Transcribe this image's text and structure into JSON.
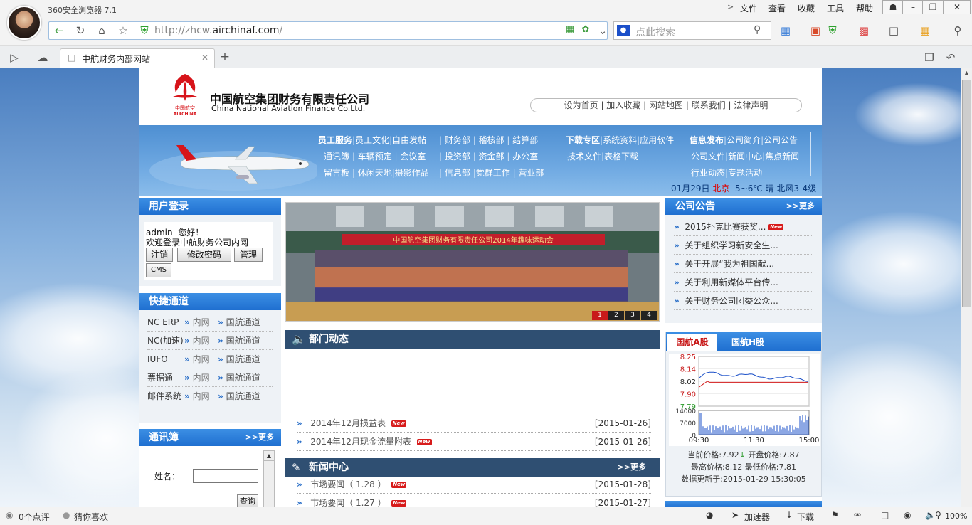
{
  "browser": {
    "name": "360安全浏览器 7.1",
    "menu": [
      "文件",
      "查看",
      "收藏",
      "工具",
      "帮助"
    ],
    "url_prefix": "http://zhcw.",
    "url_domain": "airchinaf.com",
    "url_suffix": "/",
    "search_placeholder": "点此搜索",
    "tab_title": "中航财务内部网站"
  },
  "status": {
    "comments": "0个点评",
    "guess": "猜你喜欢",
    "accelerator": "加速器",
    "download": "下载",
    "zoom": "100%"
  },
  "header": {
    "company_cn": "中国航空集团财务有限责任公司",
    "company_en": "China National Aviation Finance Co.Ltd.",
    "logo_cn": "中国航空",
    "logo_en": "AIRCHINA",
    "top_links": [
      "设为首页",
      "加入收藏",
      "网站地图",
      "联系我们",
      "法律声明"
    ]
  },
  "banner_nav": {
    "group1": {
      "title": "员工服务",
      "rows": [
        [
          "员工文化",
          "自由发帖"
        ],
        [
          "通讯簿",
          "车辆预定",
          "会议室"
        ],
        [
          "留言板",
          "休闲天地",
          "摄影作品"
        ]
      ]
    },
    "group2": {
      "rows": [
        [
          "财务部",
          "稽核部",
          "结算部"
        ],
        [
          "投资部",
          "资金部",
          "办公室"
        ],
        [
          "信息部",
          "党群工作",
          "营业部"
        ]
      ]
    },
    "group3": {
      "title": "下载专区",
      "rows": [
        [
          "系统资料",
          "应用软件"
        ],
        [
          "技术文件",
          "表格下载"
        ]
      ]
    },
    "group4": {
      "title": "信息发布",
      "rows": [
        [
          "公司简介",
          "公司公告"
        ],
        [
          "公司文件",
          "新闻中心",
          "焦点新闻"
        ],
        [
          "行业动态",
          "专题活动"
        ]
      ]
    }
  },
  "weather": {
    "date": "01月29日",
    "city": "北京",
    "temp": "5~6℃",
    "cond": "晴",
    "wind": "北风3-4级"
  },
  "login": {
    "title": "用户登录",
    "user": "admin",
    "greeting": "您好！",
    "welcome": "欢迎登录中航财务公司内网",
    "buttons": [
      "注销",
      "修改密码",
      "管理",
      "CMS"
    ]
  },
  "quick": {
    "title": "快捷通道",
    "internal": "内网",
    "external": "国航通道",
    "items": [
      "NC ERP",
      "NC(加速)",
      "IUFO",
      "票据通",
      "邮件系统"
    ]
  },
  "contacts": {
    "title": "通讯簿",
    "more": ">>更多",
    "name_label": "姓名：",
    "query": "查询"
  },
  "slideshow": {
    "caption": "中国航空集团财务有限责任公司2014年趣味运动会",
    "pages": [
      "1",
      "2",
      "3",
      "4"
    ]
  },
  "dept_news": {
    "title": "部门动态",
    "items": [
      {
        "title": "2014年12月损益表",
        "date": "[2015-01-26]"
      },
      {
        "title": "2014年12月现金流量附表",
        "date": "[2015-01-26]"
      }
    ]
  },
  "news_center": {
    "title": "新闻中心",
    "more": ">>更多",
    "items": [
      {
        "title": "市场要闻（ 1.28 ）",
        "date": "[2015-01-28]"
      },
      {
        "title": "市场要闻（ 1.27 ）",
        "date": "[2015-01-27]"
      }
    ]
  },
  "notice": {
    "title": "公司公告",
    "more": ">>更多",
    "items": [
      "2015扑克比赛获奖...",
      "关于组织学习新安全生...",
      "关于开展“我为祖国献...",
      "关于利用新媒体平台传...",
      "关于财务公司团委公众..."
    ]
  },
  "stock": {
    "tab_a": "国航A股",
    "tab_h": "国航H股",
    "price_labels": [
      "8.25",
      "8.14",
      "8.02",
      "7.90",
      "7.79"
    ],
    "vol_labels": [
      "14000",
      "7000",
      "0"
    ],
    "time_labels": [
      "09:30",
      "11:30",
      "15:00"
    ],
    "current_label": "当前价格:",
    "current": "7.92",
    "open_label": "开盘价格:",
    "open": "7.87",
    "high_label": "最高价格:",
    "high": "8.12",
    "low_label": "最低价格:",
    "low": "7.81",
    "update_label": "数据更新于:",
    "update": "2015-01-29 15:30:05",
    "new_tag": "New"
  }
}
